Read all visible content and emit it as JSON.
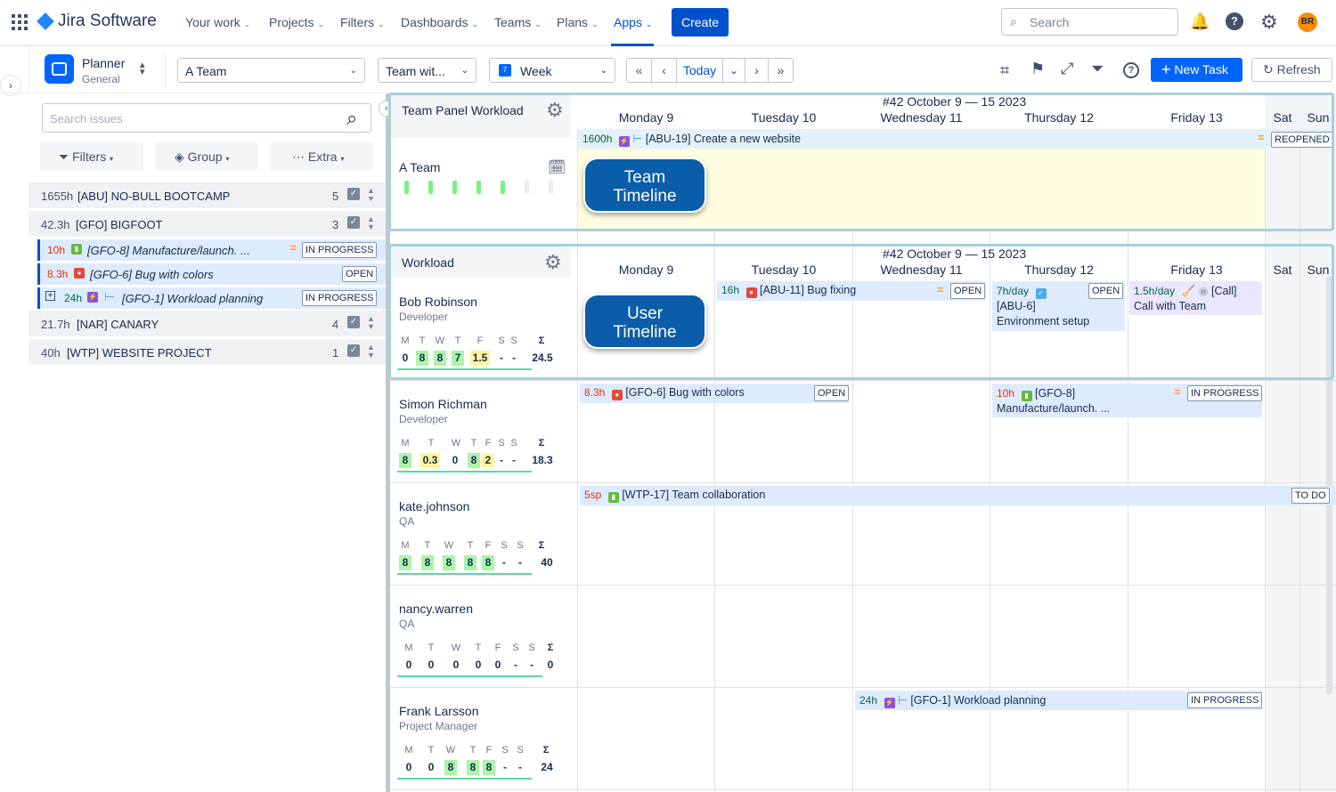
{
  "nav": {
    "product": "Jira Software",
    "items": [
      "Your work",
      "Projects",
      "Filters",
      "Dashboards",
      "Teams",
      "Plans",
      "Apps"
    ],
    "create": "Create",
    "search_placeholder": "Search",
    "avatar": "BR",
    "accent": "#0052cc"
  },
  "toolbar": {
    "app_title": "Planner",
    "app_subtitle": "General",
    "team_select": "A Team",
    "team_with": "Team wit...",
    "calendar_badge": "7",
    "period": "Week",
    "today": "Today",
    "new_task": "New Task",
    "refresh": "Refresh"
  },
  "left": {
    "search_placeholder": "Search issues",
    "filters": "Filters",
    "group": "Group",
    "extra": "Extra",
    "groups": [
      {
        "hours": "1655h",
        "name": "[ABU] NO-BULL BOOTCAMP",
        "count": "5"
      },
      {
        "hours": "42.3h",
        "name": "[GFO] BIGFOOT",
        "count": "3"
      },
      {
        "hours": "21.7h",
        "name": "[NAR] CANARY",
        "count": "4"
      },
      {
        "hours": "40h",
        "name": "[WTP] WEBSITE PROJECT",
        "count": "1"
      }
    ],
    "issues": [
      {
        "hours": "10h",
        "key": "[GFO-8] Manufacture/launch. ...",
        "status": "IN PROGRESS"
      },
      {
        "hours": "8.3h",
        "key": "[GFO-6] Bug with colors",
        "status": "OPEN"
      },
      {
        "hours": "24h",
        "key": "[GFO-1] Workload planning",
        "status": "IN PROGRESS"
      }
    ]
  },
  "team_panel": {
    "title": "Team Panel Workload",
    "week": "#42 October 9 — 15 2023",
    "days": [
      "Monday 9",
      "Tuesday 10",
      "Wednesday 11",
      "Thursday 12",
      "Friday 13",
      "Sat",
      "Sun"
    ],
    "team_name": "A Team",
    "bar": {
      "hours": "1600h",
      "text": "[ABU-19] Create a new website",
      "status": "REOPENED"
    },
    "callout": "Team Timeline"
  },
  "workload": {
    "title": "Workload",
    "week": "#42 October 9 — 15 2023",
    "callout": "User Timeline",
    "people": [
      {
        "name": "Bob Robinson",
        "role": "Developer",
        "days": [
          "M",
          "T",
          "W",
          "T",
          "F",
          "S",
          "S"
        ],
        "vals": [
          "0",
          "8",
          "8",
          "7",
          "1.5",
          "-",
          "-"
        ],
        "sum": "24.5"
      },
      {
        "name": "Simon Richman",
        "role": "Developer",
        "days": [
          "M",
          "T",
          "W",
          "T",
          "F",
          "S",
          "S"
        ],
        "vals": [
          "8",
          "0.3",
          "0",
          "8",
          "2",
          "-",
          "-"
        ],
        "sum": "18.3"
      },
      {
        "name": "kate.johnson",
        "role": "QA",
        "days": [
          "M",
          "T",
          "W",
          "T",
          "F",
          "S",
          "S"
        ],
        "vals": [
          "8",
          "8",
          "8",
          "8",
          "8",
          "-",
          "-"
        ],
        "sum": "40"
      },
      {
        "name": "nancy.warren",
        "role": "QA",
        "days": [
          "M",
          "T",
          "W",
          "T",
          "F",
          "S",
          "S"
        ],
        "vals": [
          "0",
          "0",
          "0",
          "0",
          "0",
          "-",
          "-"
        ],
        "sum": "0"
      },
      {
        "name": "Frank Larsson",
        "role": "Project Manager",
        "days": [
          "M",
          "T",
          "W",
          "T",
          "F",
          "S",
          "S"
        ],
        "vals": [
          "0",
          "0",
          "8",
          "8",
          "8",
          "-",
          "-"
        ],
        "sum": "24"
      }
    ],
    "sigma": "Σ",
    "bars": {
      "bob_bug": {
        "hours": "16h",
        "text": "[ABU-11] Bug fixing",
        "status": "OPEN"
      },
      "bob_env": {
        "hours": "7h/day",
        "key": "[ABU-6]",
        "text": "Environment setup",
        "status": "OPEN"
      },
      "bob_call": {
        "hours": "1.5h/day",
        "key": "[Call]",
        "text": "Call with Team"
      },
      "simon_bug": {
        "hours": "8.3h",
        "text": "[GFO-6] Bug with colors",
        "status": "OPEN"
      },
      "simon_gfo8": {
        "hours": "10h",
        "key": "[GFO-8]",
        "text": "Manufacture/launch. ...",
        "status": "IN PROGRESS"
      },
      "kate_wtp": {
        "hours": "5sp",
        "text": "[WTP-17] Team collaboration",
        "status": "TO DO"
      },
      "frank_gfo1": {
        "hours": "24h",
        "text": "[GFO-1] Workload planning",
        "status": "IN PROGRESS"
      }
    }
  }
}
